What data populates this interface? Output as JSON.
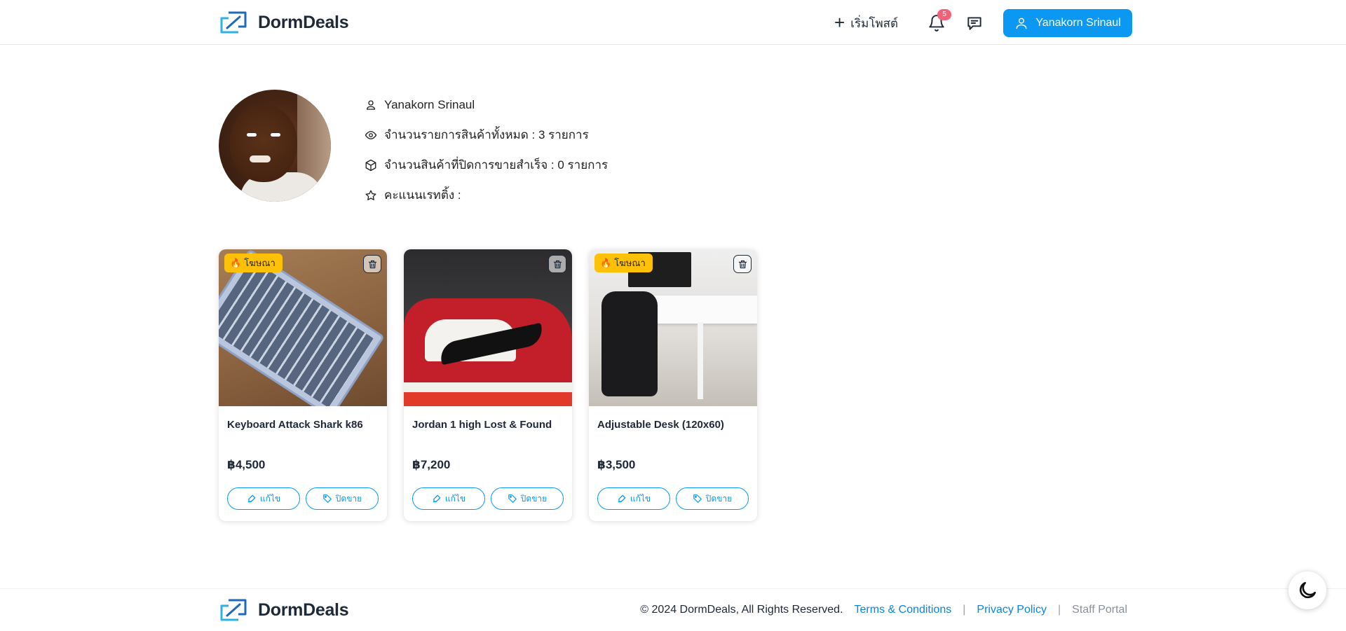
{
  "header": {
    "brand": "DormDeals",
    "post_label": "เริ่มโพสต์",
    "notification_count": "5",
    "user_name": "Yanakorn Srinaul"
  },
  "profile": {
    "name": "Yanakorn Srinaul",
    "total_items": "จำนวนรายการสินค้าทั้งหมด : 3 รายการ",
    "closed_items": "จำนวนสินค้าที่ปิดการขายสำเร็จ : 0 รายการ",
    "rating": "คะแนนเรทติ้ง :"
  },
  "products": [
    {
      "promo": "โฆษณา",
      "title": "Keyboard Attack Shark k86",
      "price": "฿4,500",
      "edit": "แก้ไข",
      "close": "ปิดขาย"
    },
    {
      "promo": "",
      "title": "Jordan 1 high Lost & Found",
      "price": "฿7,200",
      "edit": "แก้ไข",
      "close": "ปิดขาย"
    },
    {
      "promo": "โฆษณา",
      "title": "Adjustable Desk (120x60)",
      "price": "฿3,500",
      "edit": "แก้ไข",
      "close": "ปิดขาย"
    }
  ],
  "footer": {
    "brand": "DormDeals",
    "copyright": "© 2024 DormDeals, All Rights Reserved.",
    "terms": "Terms & Conditions",
    "privacy": "Privacy Policy",
    "staff": "Staff Portal",
    "separator": "|"
  },
  "colors": {
    "primary": "#0a98f2",
    "promo": "#ffc107",
    "badge": "#f26178"
  }
}
